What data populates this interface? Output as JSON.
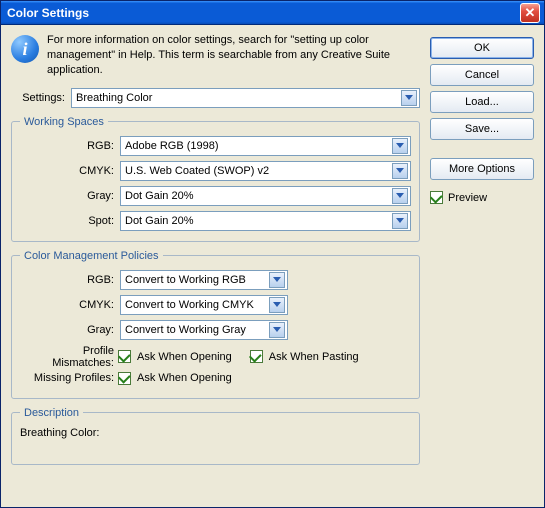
{
  "window": {
    "title": "Color Settings"
  },
  "help_text": "For more information on color settings, search for \"setting up color management\" in Help. This term is searchable from any Creative Suite application.",
  "settings": {
    "label": "Settings:",
    "value": "Breathing Color"
  },
  "working_spaces": {
    "legend": "Working Spaces",
    "rgb_label": "RGB:",
    "rgb_value": "Adobe RGB (1998)",
    "cmyk_label": "CMYK:",
    "cmyk_value": "U.S. Web Coated (SWOP) v2",
    "gray_label": "Gray:",
    "gray_value": "Dot Gain 20%",
    "spot_label": "Spot:",
    "spot_value": "Dot Gain 20%"
  },
  "policies": {
    "legend": "Color Management Policies",
    "rgb_label": "RGB:",
    "rgb_value": "Convert to Working RGB",
    "cmyk_label": "CMYK:",
    "cmyk_value": "Convert to Working CMYK",
    "gray_label": "Gray:",
    "gray_value": "Convert to Working Gray",
    "profile_mismatches_label": "Profile Mismatches:",
    "ask_open_label": "Ask When Opening",
    "ask_paste_label": "Ask When Pasting",
    "missing_profiles_label": "Missing Profiles:",
    "missing_ask_open_label": "Ask When Opening"
  },
  "description": {
    "legend": "Description",
    "text": "Breathing Color:"
  },
  "buttons": {
    "ok": "OK",
    "cancel": "Cancel",
    "load": "Load...",
    "save": "Save...",
    "more_options": "More Options",
    "preview": "Preview"
  }
}
